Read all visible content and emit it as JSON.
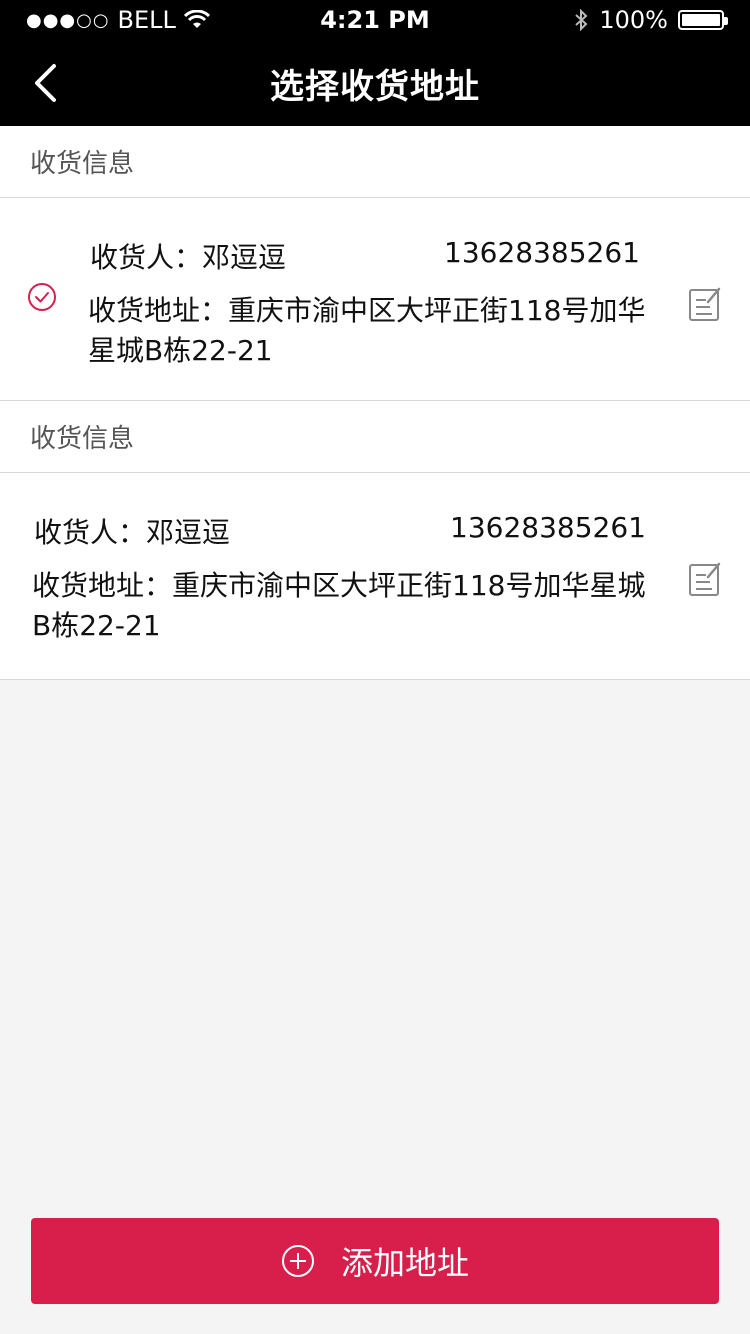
{
  "status_bar": {
    "carrier": "BELL",
    "time": "4:21 PM",
    "battery_percent": "100%"
  },
  "nav": {
    "title": "选择收货地址"
  },
  "sections": [
    {
      "header": "收货信息",
      "selected": true,
      "recipient_label": "收货人：邓逗逗",
      "phone": "13628385261",
      "address_line1": "收货地址：重庆市渝中区大坪正街118号加华",
      "address_line2": "星城B栋22-21"
    },
    {
      "header": "收货信息",
      "selected": false,
      "recipient_label": "收货人：邓逗逗",
      "phone": "13628385261",
      "address_line1": "收货地址：重庆市渝中区大坪正街118号加华星城",
      "address_line2": "B栋22-21"
    }
  ],
  "footer": {
    "add_button_label": "添加地址"
  },
  "colors": {
    "accent": "#d81f4c",
    "navbar": "#000000",
    "background": "#f4f4f4"
  }
}
